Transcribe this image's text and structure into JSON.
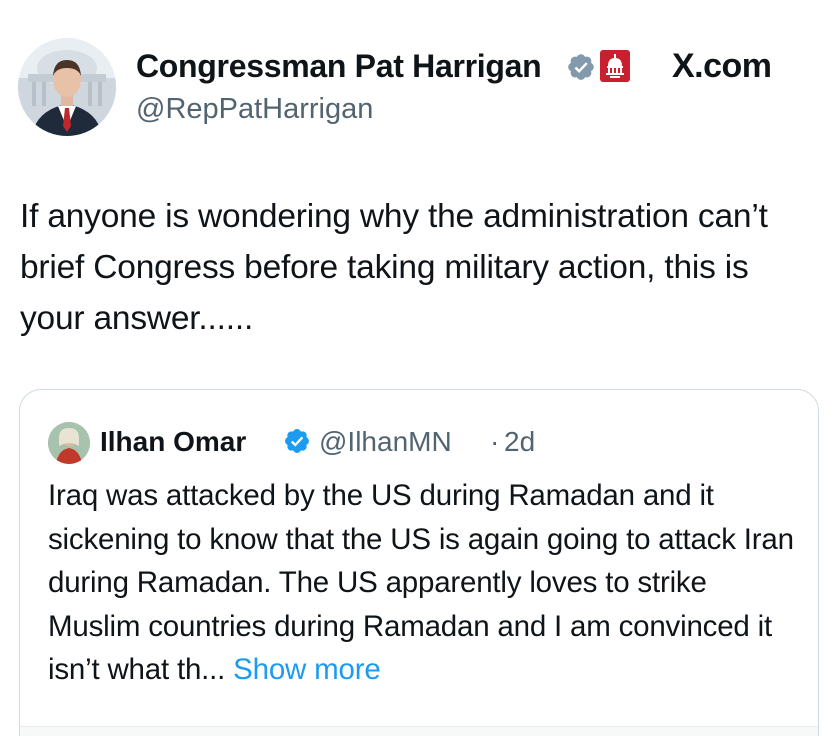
{
  "post": {
    "author": {
      "name": "Congressman Pat Harrigan",
      "handle": "@RepPatHarrigan",
      "verified_badge": "gray-verified-check-icon",
      "affiliation_badge": "us-capitol-badge-icon"
    },
    "site_label": "X.com",
    "text": "If anyone is wondering why the administration can’t brief Congress before taking military action, this is your answer......"
  },
  "quote": {
    "author": {
      "name": "Ilhan Omar",
      "handle": "@IlhanMN",
      "verified_badge": "blue-verified-check-icon"
    },
    "separator": "·",
    "time": "2d",
    "text": "Iraq was attacked by the US during Ramadan and it sickening to know that the US is again going to attack Iran during Ramadan.  The US apparently loves to strike Muslim countries during Ramadan and I am convinced it isn’t what th...",
    "show_more_label": "Show more"
  },
  "colors": {
    "text_primary": "#0f1419",
    "text_secondary": "#536471",
    "link_blue": "#1d9bf0",
    "border": "#cfd9de",
    "gov_red": "#c8202f",
    "gray_check": "#829aab"
  }
}
